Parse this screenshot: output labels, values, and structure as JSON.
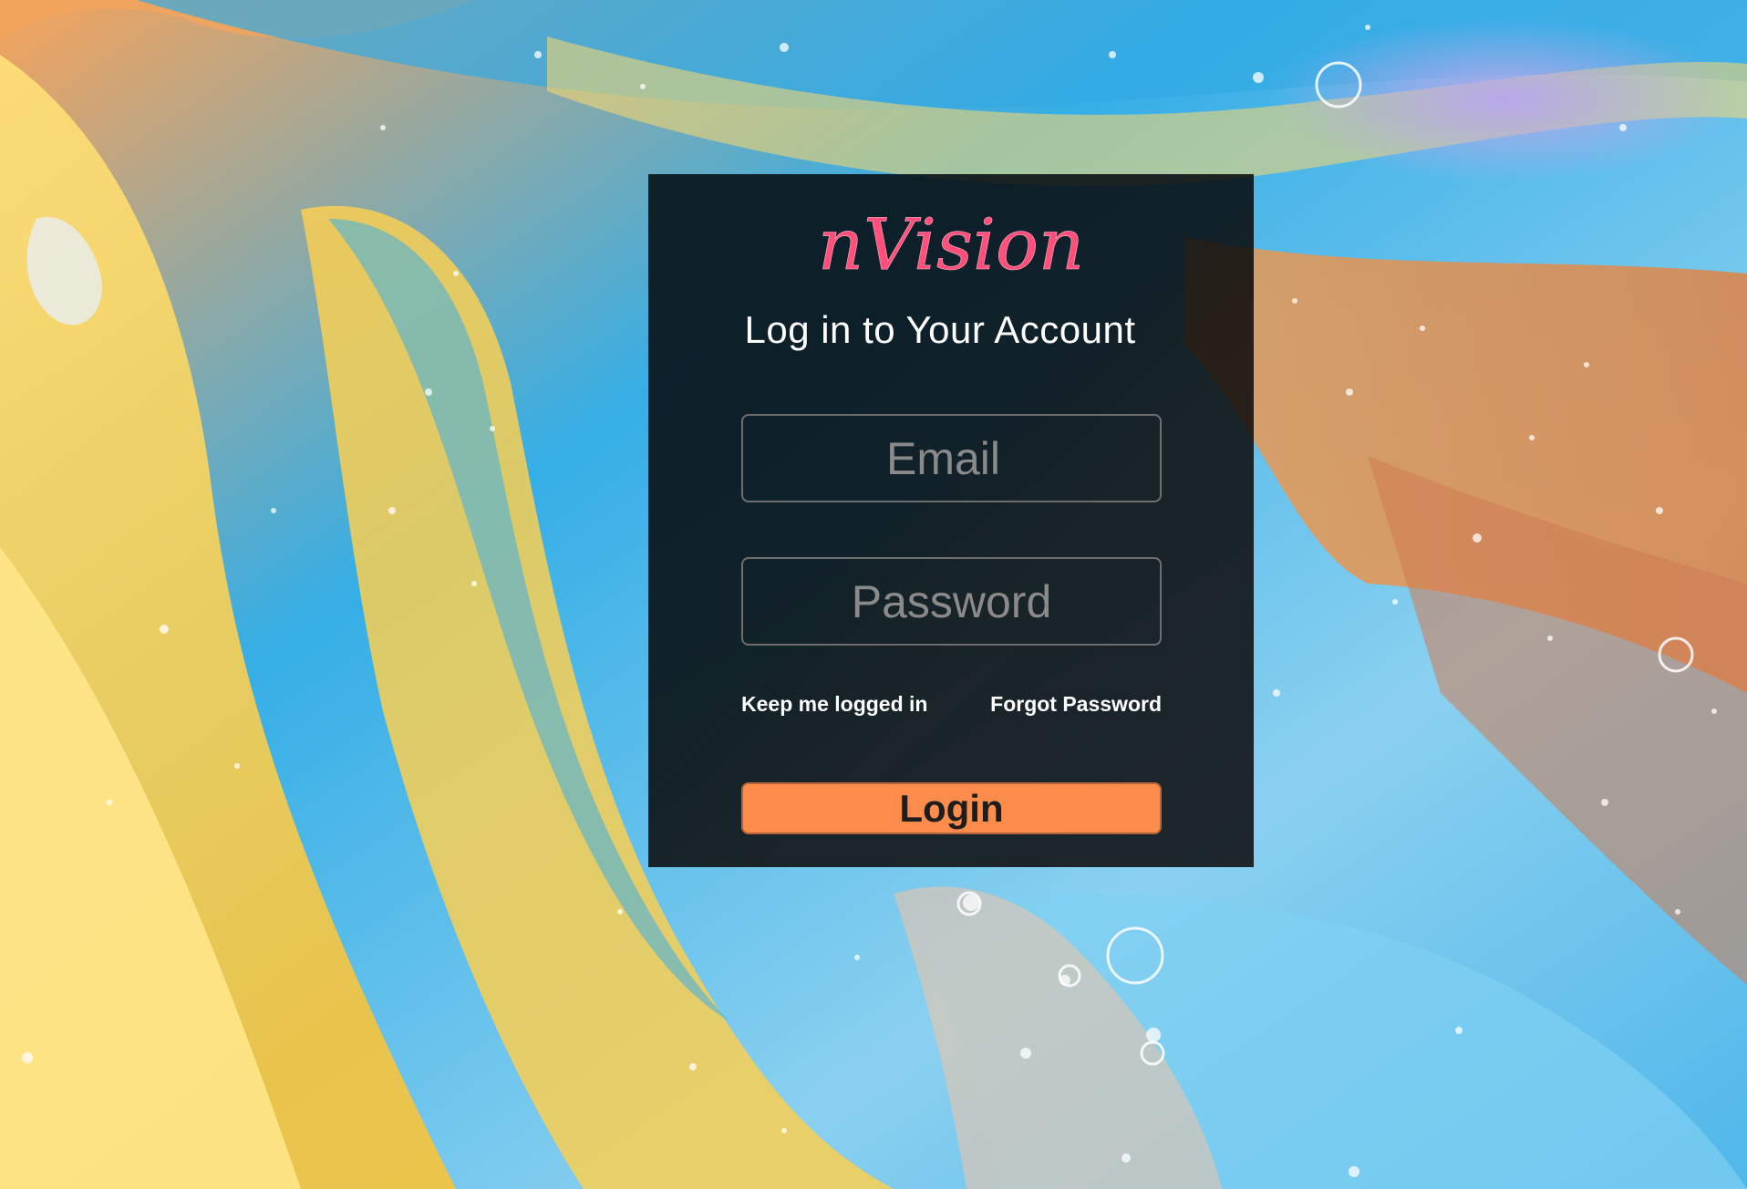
{
  "brand": {
    "logo_text": "nVision",
    "logo_color": "#ff4f7a"
  },
  "login_form": {
    "title": "Log in to Your Account",
    "email_placeholder": "Email",
    "password_placeholder": "Password",
    "keep_logged_in_label": "Keep me logged in",
    "forgot_password_label": "Forgot Password",
    "login_button_label": "Login"
  },
  "colors": {
    "card_background": "#0b0b0d",
    "login_button": "#fb8c4c",
    "text": "#ffffff",
    "placeholder": "#8a8a8a"
  },
  "background": {
    "description_icon": "abstract-liquid-background"
  }
}
